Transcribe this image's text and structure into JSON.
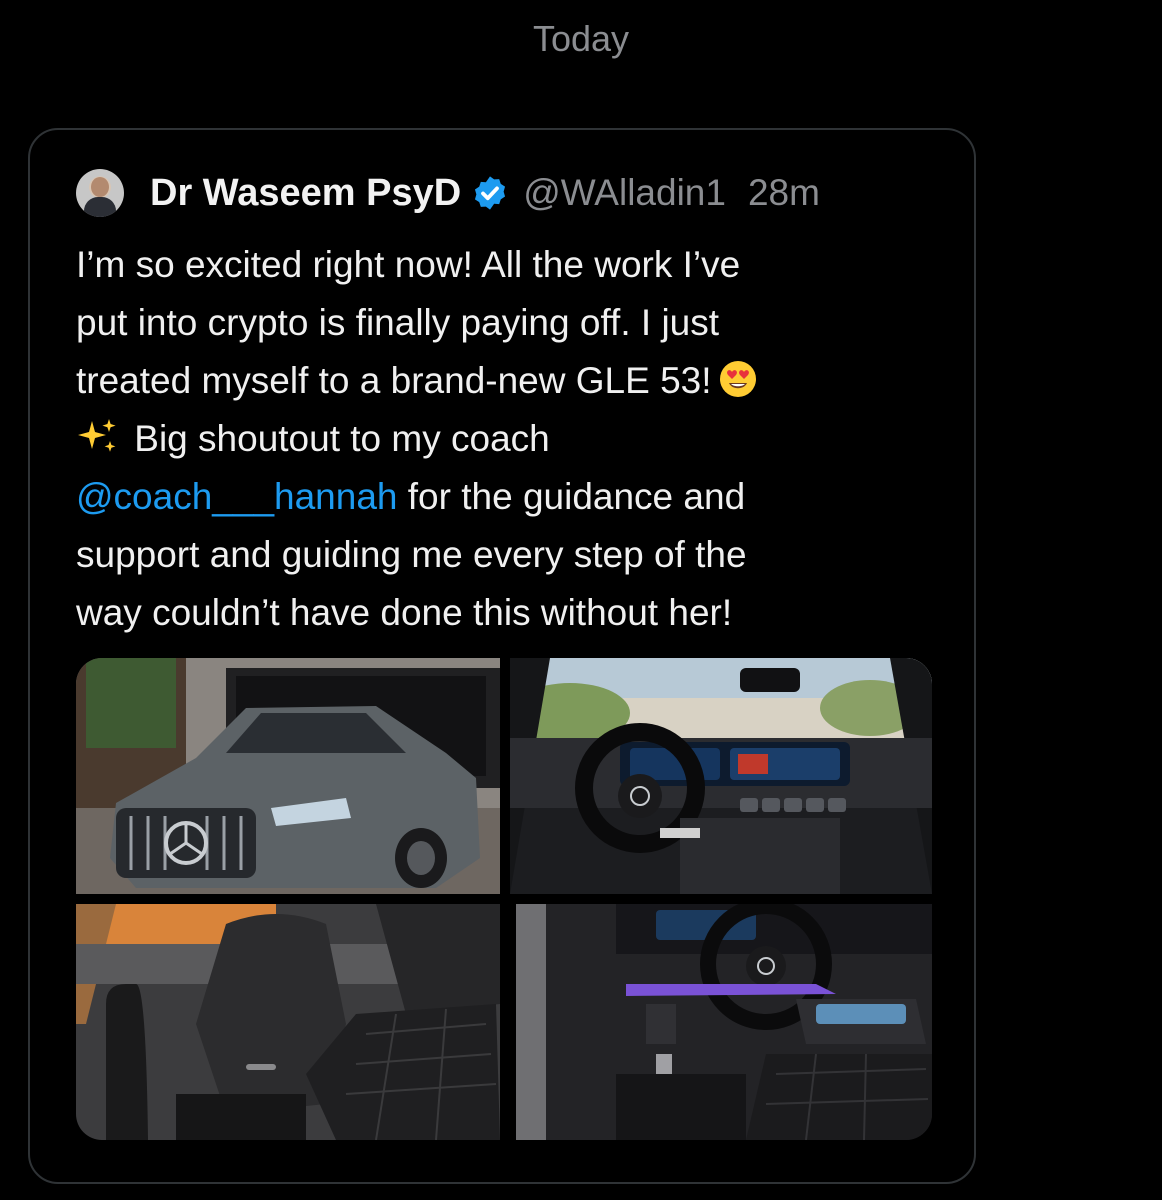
{
  "conversation": {
    "date_separator": "Today"
  },
  "tweet": {
    "author": {
      "display_name": "Dr Waseem PsyD",
      "handle": "@WAlladin1",
      "verified": true
    },
    "timestamp": "28m",
    "text_lines": {
      "line1": "I’m so excited right now! All the work I’ve",
      "line2": "put into crypto is finally paying off. I just",
      "line3": "treated myself to a brand-new GLE 53!",
      "line4": "Big shoutout to my coach",
      "mention": "@coach___hannah",
      "line5_rest": " for the guidance and",
      "line6": "support and guiding me every step of the",
      "line7": "way couldn’t have done this without her!"
    },
    "emojis": [
      "smiling-face-with-heart-eyes",
      "sparkles"
    ],
    "media": [
      {
        "kind": "photo",
        "subject": "gray Mercedes-AMG GLE 53 parked in front of a garage"
      },
      {
        "kind": "photo",
        "subject": "steering wheel and digital dashboard interior"
      },
      {
        "kind": "photo",
        "subject": "black quilted leather front seats"
      },
      {
        "kind": "photo",
        "subject": "driver footwell, pedals and center console"
      }
    ]
  },
  "colors": {
    "background": "#000000",
    "card_border": "#2f3336",
    "primary_text": "#e7e9ea",
    "secondary_text": "#8b8d91",
    "link": "#1d9bf0",
    "verified": "#1d9bf0"
  }
}
